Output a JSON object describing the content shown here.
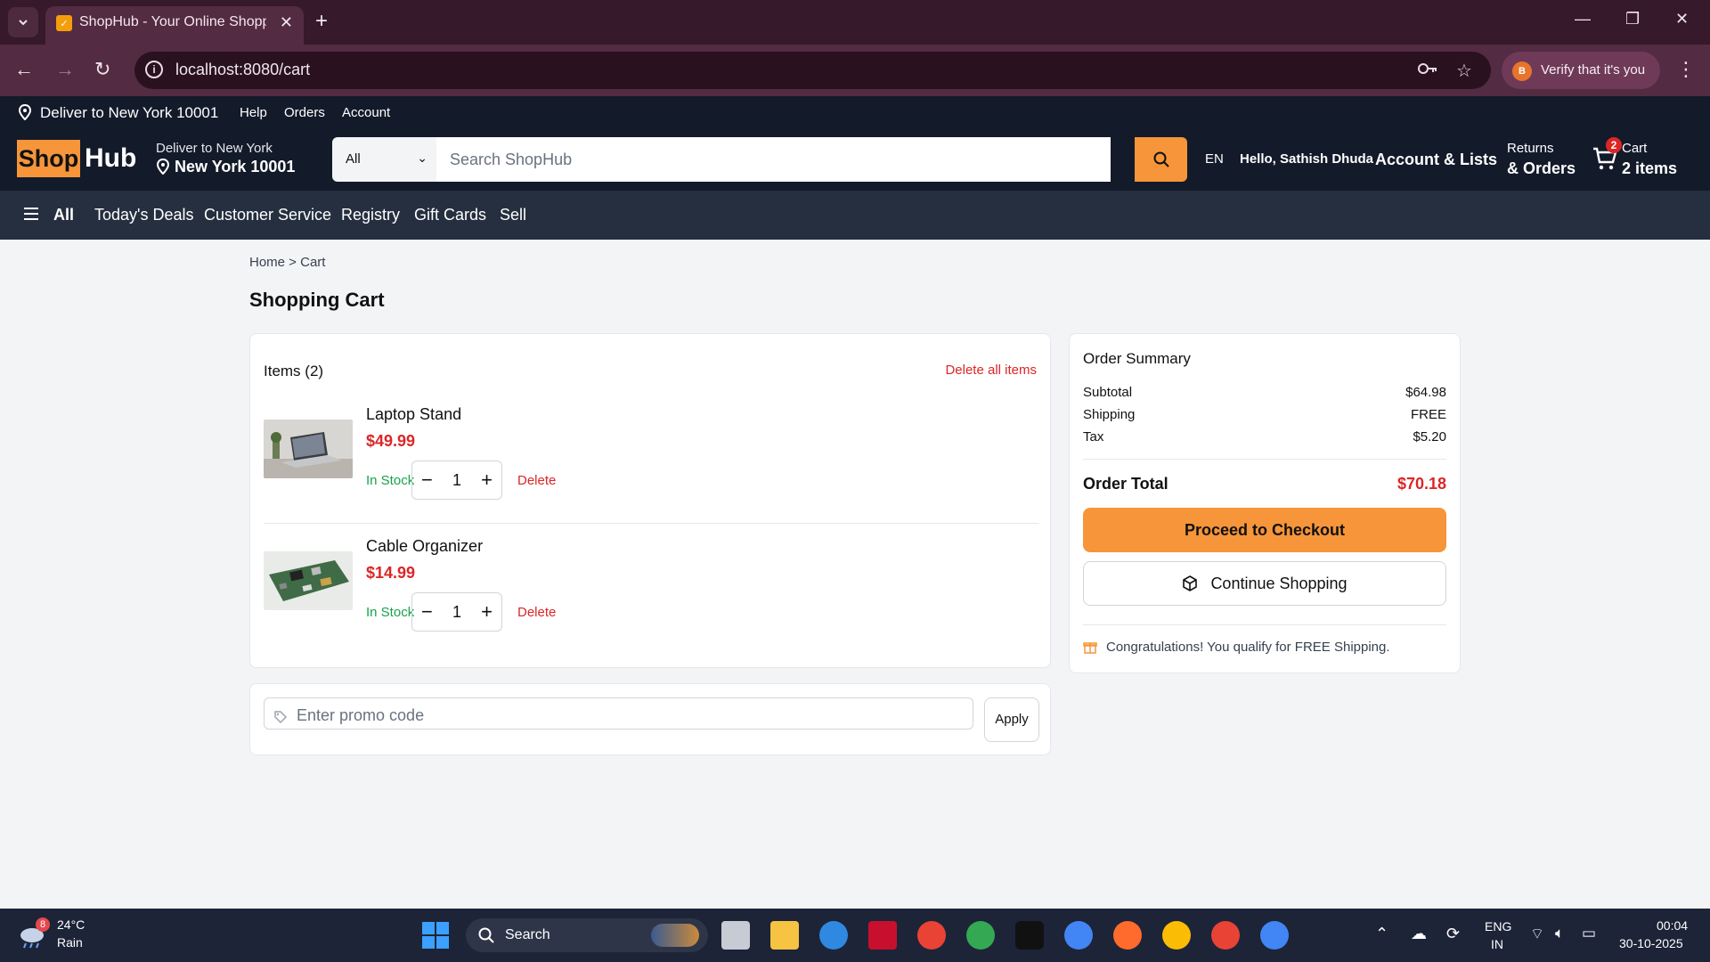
{
  "browser": {
    "tab_title": "ShopHub - Your Online Shoppi",
    "url": "localhost:8080/cart",
    "verify_label": "Verify that it's you",
    "verify_avatar_letter": "B"
  },
  "topstrip": {
    "deliver": "Deliver to New York 10001",
    "help": "Help",
    "orders": "Orders",
    "account": "Account"
  },
  "header": {
    "logo_shop": "Shop",
    "logo_hub": "Hub",
    "deliver_small": "Deliver to New York",
    "deliver_big": "New York 10001",
    "search_category": "All",
    "search_placeholder": "Search ShopHub",
    "lang": "EN",
    "hello": "Hello, Sathish Dhuda",
    "account_lists": "Account & Lists",
    "returns": "Returns",
    "returns_orders": "& Orders",
    "cart_label": "Cart",
    "cart_items": "2 items",
    "cart_count": "2"
  },
  "subnav": {
    "all": "All",
    "items": [
      "Today's Deals",
      "Customer Service",
      "Registry",
      "Gift Cards",
      "Sell"
    ]
  },
  "breadcrumb": "Home > Cart",
  "page_title": "Shopping Cart",
  "cart": {
    "items_heading": "Items (2)",
    "delete_all": "Delete all items",
    "items": [
      {
        "name": "Laptop Stand",
        "price": "$49.99",
        "stock": "In Stock",
        "qty": "1",
        "delete": "Delete"
      },
      {
        "name": "Cable Organizer",
        "price": "$14.99",
        "stock": "In Stock",
        "qty": "1",
        "delete": "Delete"
      }
    ]
  },
  "promo": {
    "placeholder": "Enter promo code",
    "apply": "Apply"
  },
  "summary": {
    "title": "Order Summary",
    "subtotal_label": "Subtotal",
    "subtotal": "$64.98",
    "shipping_label": "Shipping",
    "shipping": "FREE",
    "tax_label": "Tax",
    "tax": "$5.20",
    "total_label": "Order Total",
    "total": "$70.18",
    "checkout": "Proceed to Checkout",
    "continue": "Continue Shopping",
    "congrats": "Congratulations! You qualify for FREE Shipping."
  },
  "taskbar": {
    "weather_temp": "24°C",
    "weather_cond": "Rain",
    "weather_badge": "8",
    "search": "Search",
    "lang_top": "ENG",
    "lang_bottom": "IN",
    "time": "00:04",
    "date": "30-10-2025"
  },
  "colors": {
    "brand_orange": "#f6953a",
    "header_navy": "#131a2a",
    "subnav_slate": "#252f3f",
    "price_red": "#dc2626",
    "stock_green": "#16a34a",
    "browser_plum": "#532b42"
  }
}
